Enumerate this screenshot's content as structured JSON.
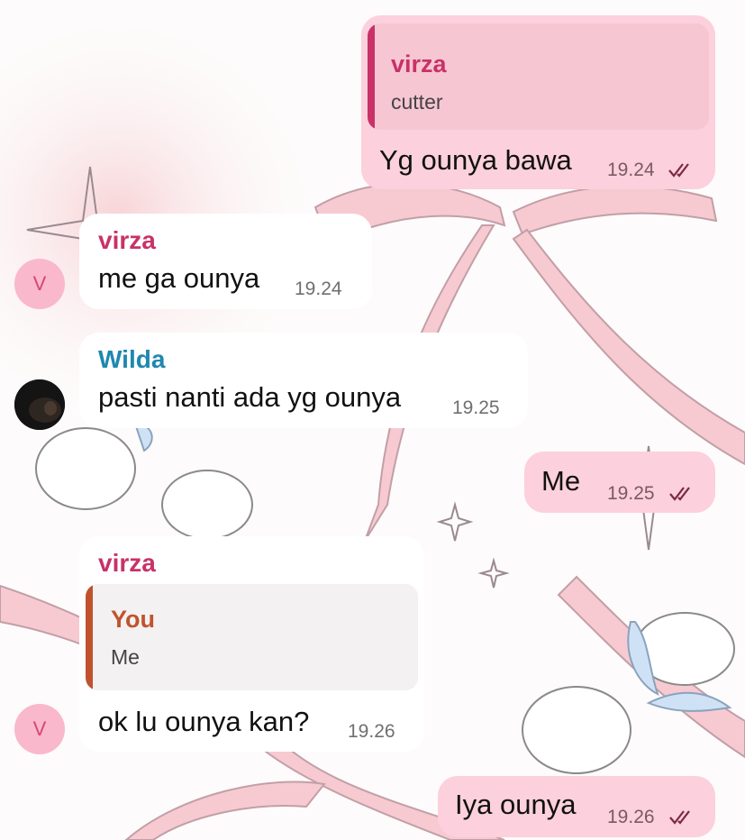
{
  "colors": {
    "outgoing_bubble": "#fcd0dc",
    "incoming_bubble": "#ffffff",
    "virza_name": "#c83268",
    "wilda_name": "#1f88b0",
    "you_name": "#c0532e",
    "read_ticks": "#7a2a40",
    "avatar_v_bg": "#f9b8cc",
    "avatar_v_text": "#d4467a"
  },
  "messages": [
    {
      "direction": "out",
      "quote": {
        "name": "virza",
        "text": "cutter"
      },
      "text": "Yg ounya bawa",
      "time": "19.24",
      "status": "read"
    },
    {
      "direction": "in",
      "sender": "virza",
      "text": "me ga ounya",
      "time": "19.24",
      "avatar": "V"
    },
    {
      "direction": "in",
      "sender": "Wilda",
      "text": "pasti nanti ada yg ounya",
      "time": "19.25"
    },
    {
      "direction": "out",
      "text": "Me",
      "time": "19.25",
      "status": "read"
    },
    {
      "direction": "in",
      "sender": "virza",
      "quote": {
        "name": "You",
        "text": "Me"
      },
      "text": "ok lu ounya kan?",
      "time": "19.26",
      "avatar": "V"
    },
    {
      "direction": "out",
      "text": "Iya ounya",
      "time": "19.26",
      "status": "read"
    }
  ]
}
